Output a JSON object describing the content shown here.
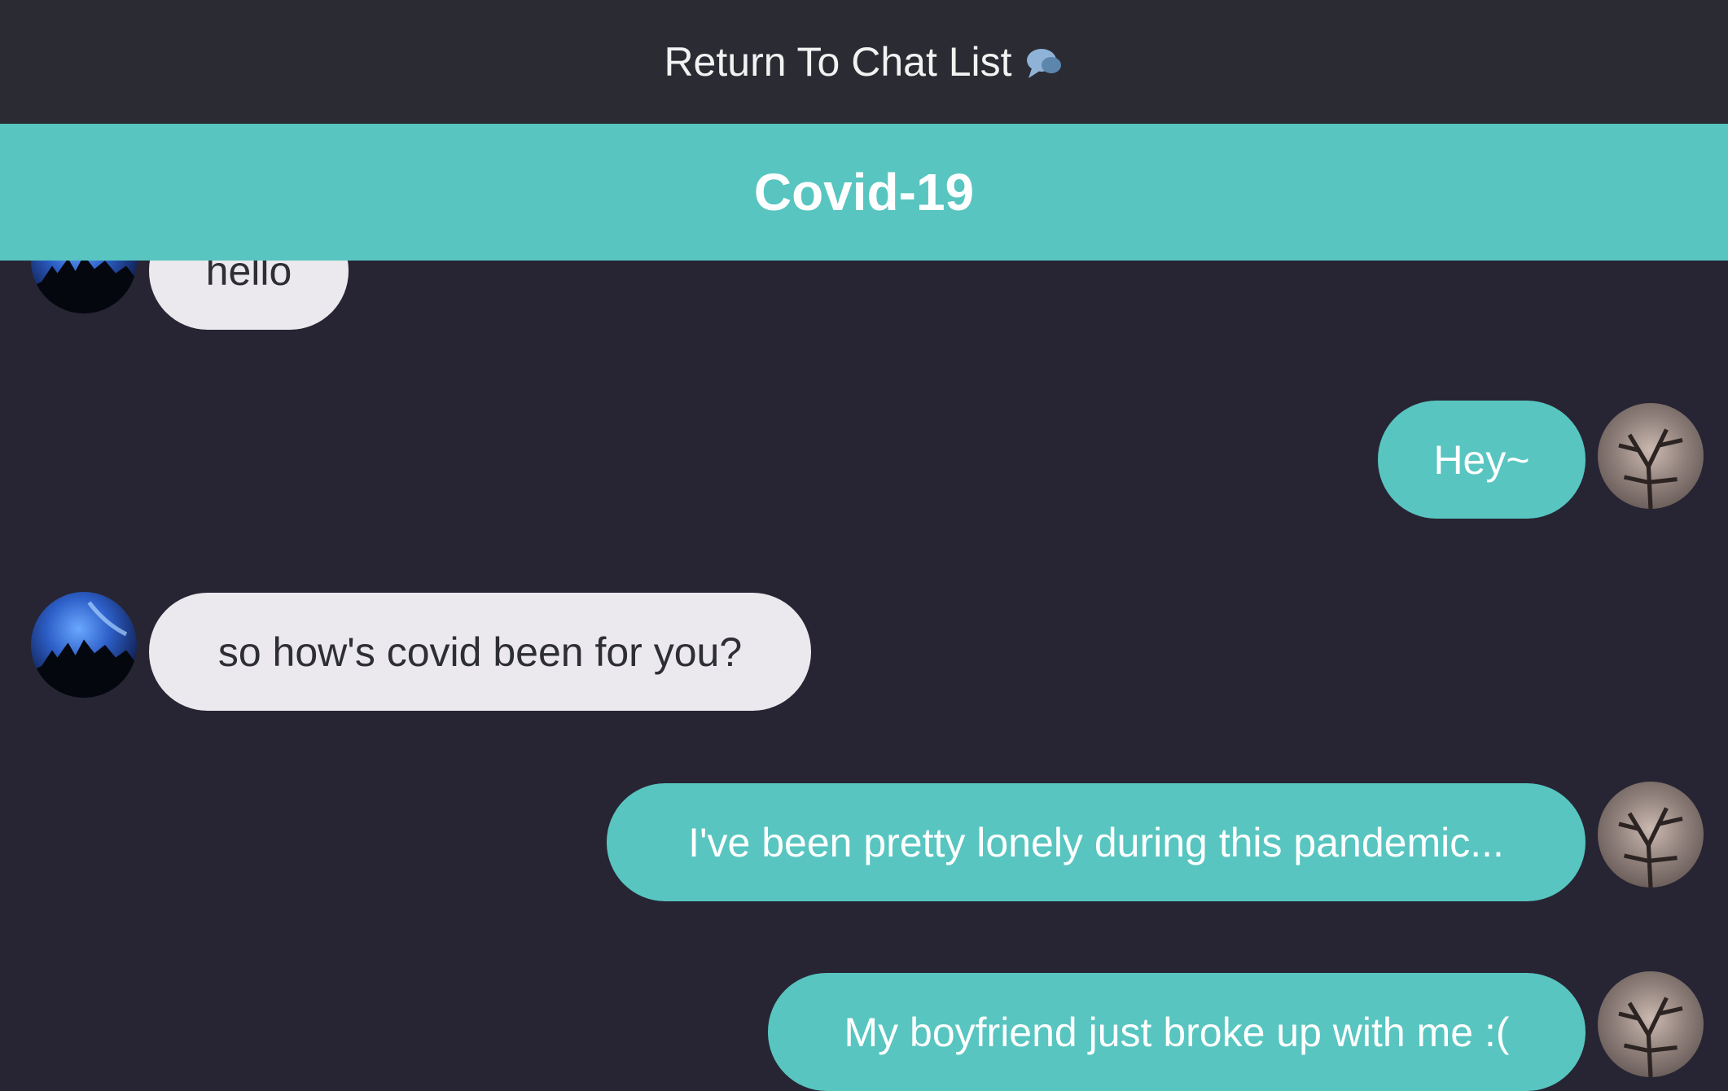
{
  "header": {
    "return_label": "Return To Chat List",
    "return_icon": "speech-bubble-icon"
  },
  "chat": {
    "title": "Covid-19"
  },
  "colors": {
    "background": "#272533",
    "topbar": "#2a2b33",
    "accent": "#58c5c0",
    "incoming_bubble": "#ebe9ee"
  },
  "messages": [
    {
      "sender": "other",
      "text": "hello"
    },
    {
      "sender": "self",
      "text": "Hey~"
    },
    {
      "sender": "other",
      "text": "so how's covid been for you?"
    },
    {
      "sender": "self",
      "text": "I've been pretty lonely during this pandemic..."
    },
    {
      "sender": "self",
      "text": "My boyfriend just broke up with me :("
    }
  ]
}
